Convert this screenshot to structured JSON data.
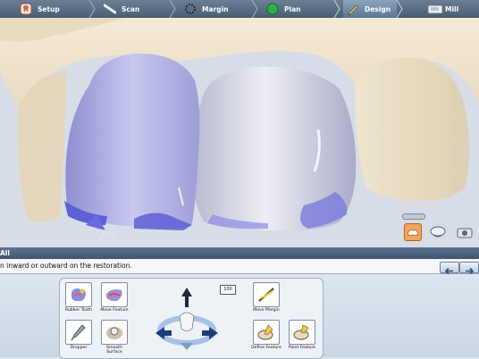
{
  "workflow": {
    "steps": [
      {
        "label": "Setup",
        "icon": "tooth-setup-icon"
      },
      {
        "label": "Scan",
        "icon": "scan-wand-icon"
      },
      {
        "label": "Margin",
        "icon": "margin-ring-icon"
      },
      {
        "label": "Plan",
        "icon": "green-dot-icon"
      },
      {
        "label": "Design",
        "icon": "pencil-icon",
        "active": true
      },
      {
        "label": "Mill",
        "icon": "mill-machine-icon"
      }
    ]
  },
  "viewport": {
    "view_buttons": [
      "occlusal-view-icon",
      "tooth-view-icon",
      "camera-view-icon"
    ]
  },
  "panel": {
    "title": "All",
    "instruction": "n inward or outward on the restoration.",
    "tools": [
      {
        "label": "Rubber Tooth",
        "icon": "rubber-tooth-icon"
      },
      {
        "label": "Move Feature",
        "icon": "move-feature-icon"
      },
      {
        "label": "Dropper",
        "icon": "dropper-icon"
      },
      {
        "label": "Smooth Surface",
        "icon": "smooth-surface-icon"
      },
      {
        "label": "Move Margin",
        "icon": "move-margin-icon"
      },
      {
        "label": "Define Feature",
        "icon": "define-feature-icon"
      },
      {
        "label": "Paint Feature",
        "icon": "paint-feature-icon"
      }
    ],
    "stepper_value": "100"
  },
  "colors": {
    "toolbar": "#51657c",
    "tooth": "#ece1cc",
    "restoration": "#a4a6e6",
    "margin_blue": "#6f6fe0"
  }
}
